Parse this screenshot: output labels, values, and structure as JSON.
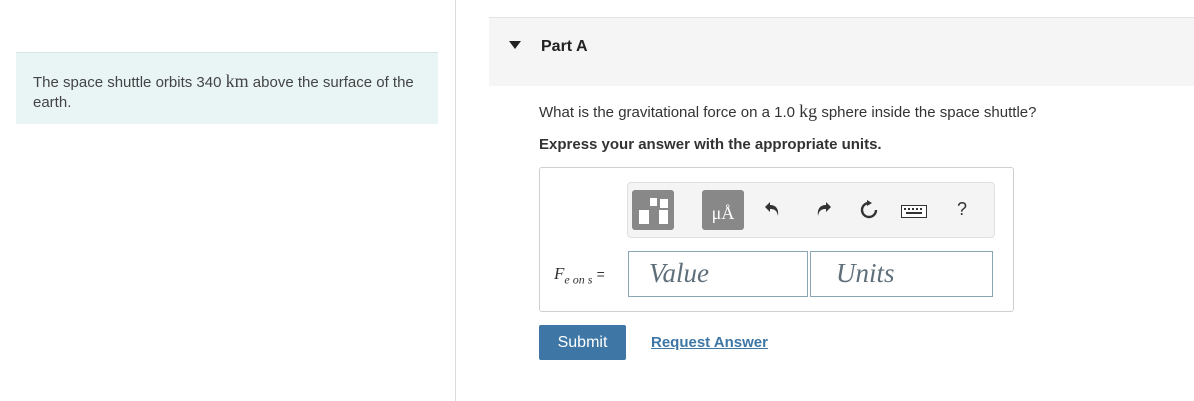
{
  "problem": {
    "text_before": "The space shuttle orbits 340 ",
    "unit": "km",
    "text_after": " above the surface of the earth."
  },
  "part": {
    "title": "Part A"
  },
  "question": {
    "text_before": "What is the gravitational force on a 1.0 ",
    "unit": "kg",
    "text_after": " sphere inside the space shuttle?"
  },
  "instruction": "Express your answer with the appropriate units.",
  "toolbar": {
    "units_button_label": "μÅ",
    "help_label": "?",
    "icons": [
      "templates-icon",
      "units-icon",
      "undo-icon",
      "redo-icon",
      "reset-icon",
      "keyboard-icon",
      "help-icon"
    ]
  },
  "answer": {
    "symbol": "F",
    "subscript": "e on s",
    "equals": "=",
    "value_placeholder": "Value",
    "units_placeholder": "Units"
  },
  "actions": {
    "submit_label": "Submit",
    "request_answer_label": "Request Answer"
  },
  "colors": {
    "accent": "#3e77a6",
    "problem_bg": "#e9f5f5",
    "header_bg": "#f5f5f5"
  }
}
